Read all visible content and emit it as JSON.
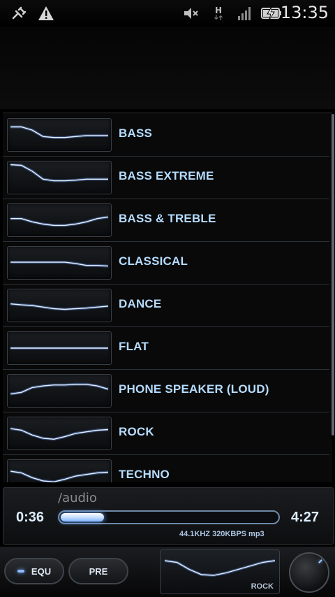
{
  "status_bar": {
    "time": "13:35",
    "network_type": "H",
    "icons": [
      "usb-debug-icon",
      "warning-icon",
      "mute-icon",
      "network-h-icon",
      "signal-icon",
      "battery-charging-icon"
    ]
  },
  "presets": [
    {
      "label": "BASS",
      "curve": [
        0.25,
        0.25,
        0.35,
        0.55,
        0.58,
        0.58,
        0.55,
        0.52,
        0.52,
        0.52
      ]
    },
    {
      "label": "BASS EXTREME",
      "curve": [
        0.1,
        0.12,
        0.3,
        0.55,
        0.6,
        0.6,
        0.58,
        0.55,
        0.55,
        0.55
      ]
    },
    {
      "label": "BASS & TREBLE",
      "curve": [
        0.45,
        0.45,
        0.55,
        0.62,
        0.66,
        0.66,
        0.62,
        0.55,
        0.45,
        0.4
      ]
    },
    {
      "label": "CLASSICAL",
      "curve": [
        0.48,
        0.48,
        0.48,
        0.48,
        0.48,
        0.48,
        0.52,
        0.58,
        0.58,
        0.6
      ]
    },
    {
      "label": "DANCE",
      "curve": [
        0.45,
        0.48,
        0.5,
        0.55,
        0.6,
        0.62,
        0.6,
        0.58,
        0.55,
        0.52
      ]
    },
    {
      "label": "FLAT",
      "curve": [
        0.5,
        0.5,
        0.5,
        0.5,
        0.5,
        0.5,
        0.5,
        0.5,
        0.5,
        0.5
      ]
    },
    {
      "label": "PHONE SPEAKER (LOUD)",
      "curve": [
        0.6,
        0.55,
        0.4,
        0.35,
        0.32,
        0.32,
        0.3,
        0.3,
        0.35,
        0.45
      ]
    },
    {
      "label": "ROCK",
      "curve": [
        0.35,
        0.4,
        0.55,
        0.65,
        0.68,
        0.6,
        0.5,
        0.45,
        0.4,
        0.38
      ]
    },
    {
      "label": "TECHNO",
      "curve": [
        0.35,
        0.4,
        0.55,
        0.65,
        0.68,
        0.6,
        0.5,
        0.45,
        0.4,
        0.38
      ]
    }
  ],
  "player": {
    "path": "/audio",
    "elapsed": "0:36",
    "duration": "4:27",
    "progress_fraction": 0.135,
    "meta": "44.1KHZ  320KBPS  mp3"
  },
  "controls": {
    "equ_label": "EQU",
    "pre_label": "PRE",
    "current_preset": "ROCK",
    "current_curve": [
      0.3,
      0.35,
      0.55,
      0.7,
      0.72,
      0.65,
      0.55,
      0.45,
      0.35,
      0.3
    ]
  },
  "colors": {
    "accent": "#b5dcff",
    "glow": "#7fb0ff"
  }
}
